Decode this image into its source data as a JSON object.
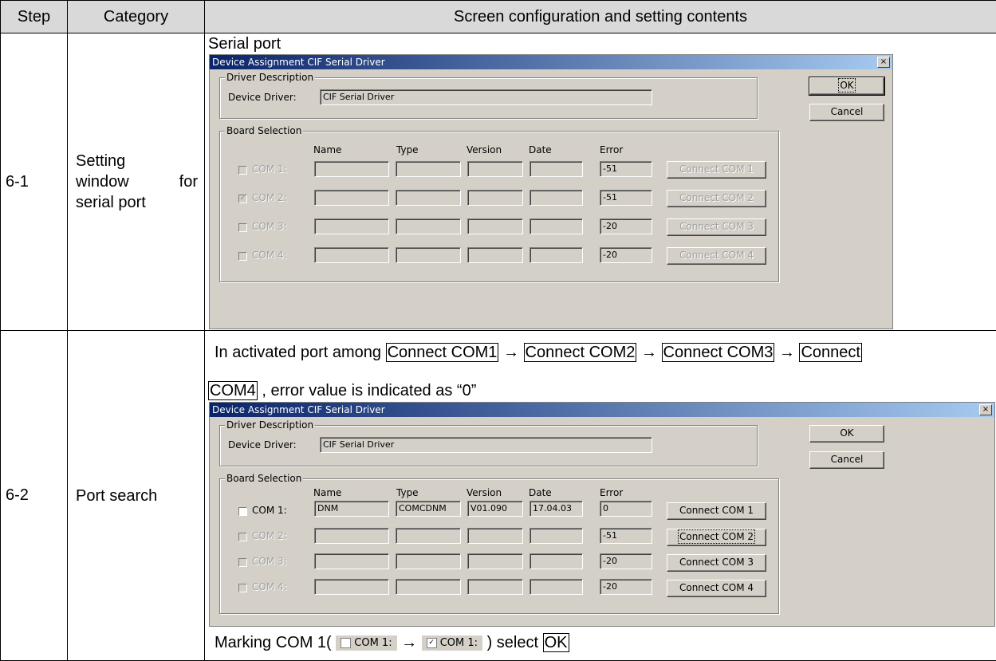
{
  "headers": {
    "step": "Step",
    "category": "Category",
    "content": "Screen configuration and setting contents"
  },
  "rows": [
    {
      "step": "6-1",
      "category_lines": [
        "Setting",
        "window for",
        "serial port"
      ],
      "section_title": "Serial port",
      "dialog": {
        "title": "Device Assignment CIF Serial Driver",
        "close": "×",
        "driver_group": "Driver Description",
        "device_driver_label": "Device Driver:",
        "device_driver_value": "CIF Serial Driver",
        "ok": "OK",
        "cancel": "Cancel",
        "board_group": "Board Selection",
        "col_name": "Name",
        "col_type": "Type",
        "col_version": "Version",
        "col_date": "Date",
        "col_error": "Error",
        "ports": [
          {
            "label": "COM 1:",
            "checked": false,
            "name": "",
            "type": "",
            "version": "",
            "date": "",
            "error": "-51",
            "button": "Connect COM 1"
          },
          {
            "label": "COM 2:",
            "checked": true,
            "name": "",
            "type": "",
            "version": "",
            "date": "",
            "error": "-51",
            "button": "Connect COM 2"
          },
          {
            "label": "COM 3:",
            "checked": false,
            "name": "",
            "type": "",
            "version": "",
            "date": "",
            "error": "-20",
            "button": "Connect COM 3"
          },
          {
            "label": "COM 4:",
            "checked": false,
            "name": "",
            "type": "",
            "version": "",
            "date": "",
            "error": "-20",
            "button": "Connect COM 4"
          }
        ]
      }
    },
    {
      "step": "6-2",
      "category_lines": [
        "Port search"
      ],
      "instr_prefix": "In activated port among",
      "instr_btn1": "Connect COM1",
      "instr_btn2": "Connect COM2",
      "instr_btn3": "Connect COM3",
      "instr_btn4a": "Connect",
      "instr_btn4b": "COM4",
      "instr_suffix": ", error value is indicated as “0”",
      "arrow": "→",
      "dialog": {
        "title": "Device Assignment CIF Serial Driver",
        "close": "×",
        "driver_group": "Driver Description",
        "device_driver_label": "Device Driver:",
        "device_driver_value": "CIF Serial Driver",
        "ok": "OK",
        "cancel": "Cancel",
        "board_group": "Board Selection",
        "col_name": "Name",
        "col_type": "Type",
        "col_version": "Version",
        "col_date": "Date",
        "col_error": "Error",
        "ports": [
          {
            "label": "COM 1:",
            "checked": false,
            "name": "DNM",
            "type": "COMCDNM",
            "version": "V01.090",
            "date": "17.04.03",
            "error": "0",
            "button": "Connect COM 1"
          },
          {
            "label": "COM 2:",
            "checked": false,
            "name": "",
            "type": "",
            "version": "",
            "date": "",
            "error": "-51",
            "button": "Connect COM 2"
          },
          {
            "label": "COM 3:",
            "checked": false,
            "name": "",
            "type": "",
            "version": "",
            "date": "",
            "error": "-20",
            "button": "Connect COM 3"
          },
          {
            "label": "COM 4:",
            "checked": false,
            "name": "",
            "type": "",
            "version": "",
            "date": "",
            "error": "-20",
            "button": "Connect COM 4"
          }
        ]
      },
      "marking_prefix": "Marking COM 1(",
      "marking_com_label": "COM 1:",
      "marking_mid": "→",
      "marking_suffix": ") select",
      "marking_ok": "OK"
    }
  ]
}
